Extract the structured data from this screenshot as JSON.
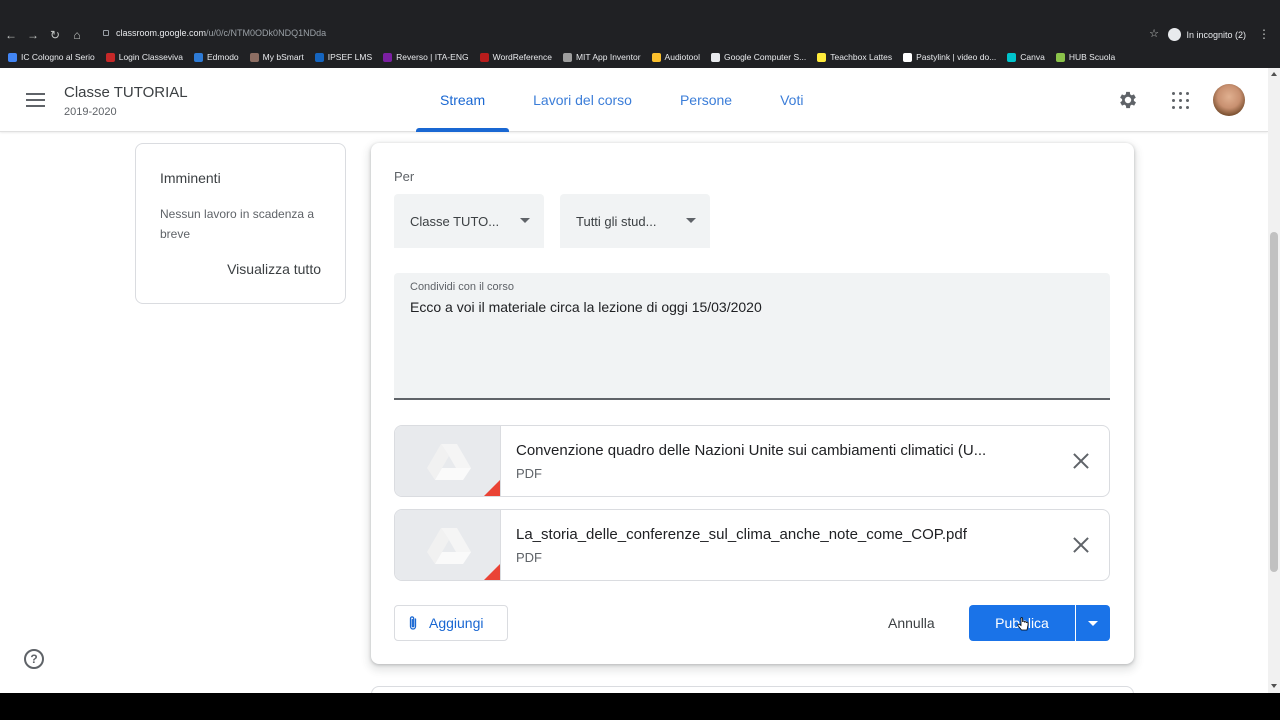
{
  "browser": {
    "url_host": "classroom.google.com",
    "url_path": "/u/0/c/NTM0ODk0NDQ1NDda",
    "incognito_label": "In incognito (2)",
    "bookmarks": [
      {
        "label": "IC Cologno al Serio",
        "color": "#4285f4"
      },
      {
        "label": "Login Classeviva",
        "color": "#c62828"
      },
      {
        "label": "Edmodo",
        "color": "#2e7bd6"
      },
      {
        "label": "My bSmart",
        "color": "#8d6e63"
      },
      {
        "label": "IPSEF LMS",
        "color": "#1565c0"
      },
      {
        "label": "Reverso | ITA-ENG",
        "color": "#7b1fa2"
      },
      {
        "label": "WordReference",
        "color": "#b71c1c"
      },
      {
        "label": "MIT App Inventor",
        "color": "#9e9e9e"
      },
      {
        "label": "Audiotool",
        "color": "#fbc02d"
      },
      {
        "label": "Google Computer S...",
        "color": "#e8eaed"
      },
      {
        "label": "Teachbox Lattes",
        "color": "#ffeb3b"
      },
      {
        "label": "Pastylink | video do...",
        "color": "#ffffff"
      },
      {
        "label": "Canva",
        "color": "#00c4cc"
      },
      {
        "label": "HUB Scuola",
        "color": "#8bc34a"
      }
    ]
  },
  "header": {
    "class_title": "Classe TUTORIAL",
    "class_year": "2019-2020",
    "tabs": [
      {
        "label": "Stream",
        "active": true
      },
      {
        "label": "Lavori del corso",
        "active": false
      },
      {
        "label": "Persone",
        "active": false
      },
      {
        "label": "Voti",
        "active": false
      }
    ]
  },
  "upcoming": {
    "title": "Imminenti",
    "message": "Nessun lavoro in scadenza a breve",
    "link": "Visualizza tutto"
  },
  "composer": {
    "for_label": "Per",
    "class_select": "Classe TUTO...",
    "students_select": "Tutti gli stud...",
    "share_label": "Condividi con il corso",
    "share_value": "Ecco a voi il materiale circa la lezione di oggi 15/03/2020",
    "attachments": [
      {
        "title": "Convenzione quadro delle Nazioni Unite sui cambiamenti climatici (U...",
        "type": "PDF"
      },
      {
        "title": "La_storia_delle_conferenze_sul_clima_anche_note_come_COP.pdf",
        "type": "PDF"
      }
    ],
    "add_label": "Aggiungi",
    "cancel_label": "Annulla",
    "publish_label": "Pubblica"
  },
  "help_label": "?",
  "colors": {
    "accent": "#1967d2",
    "publish": "#1a73e8",
    "pdf": "#ea4335"
  }
}
